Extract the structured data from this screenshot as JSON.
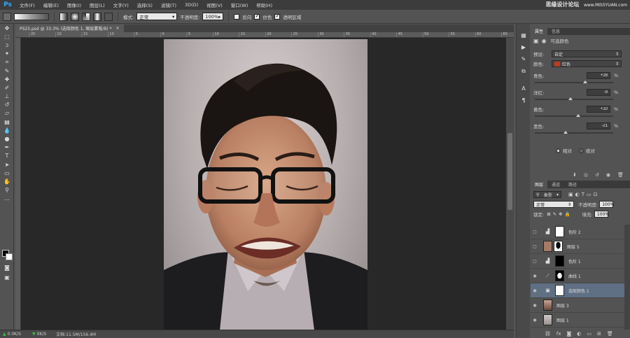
{
  "app": {
    "logo": "Ps"
  },
  "menu": [
    "文件(F)",
    "编辑(E)",
    "图像(I)",
    "图层(L)",
    "文字(Y)",
    "选择(S)",
    "滤镜(T)",
    "3D(D)",
    "视图(V)",
    "窗口(W)",
    "帮助(H)"
  ],
  "watermark": {
    "brand": "思缘设计论坛",
    "url": "www.MISSYUAN.com"
  },
  "options": {
    "mode_label": "模式:",
    "mode_value": "正常",
    "opacity_label": "不透明度:",
    "opacity_value": "100%",
    "reverse_label": "反向",
    "dither_label": "仿色",
    "transparency_label": "透明区域"
  },
  "document": {
    "tab_title": "PS25.psd @ 33.3% (选取颜色 1, 图层蒙版/8) *",
    "close": "×"
  },
  "ruler_ticks": [
    "25",
    "20",
    "15",
    "10",
    "5",
    "0",
    "5",
    "10",
    "15",
    "20",
    "25",
    "30",
    "35",
    "40",
    "45",
    "50",
    "55",
    "60",
    "65"
  ],
  "status": {
    "net_up": "0.0K/S",
    "net_down": "0K/S",
    "doc_info": "文档:11.5M/156.4M"
  },
  "properties": {
    "tabs": [
      "属性",
      "信息"
    ],
    "title": "可选颜色",
    "preset_label": "预设:",
    "preset_value": "自定",
    "colors_label": "颜色:",
    "colors_value": "红色",
    "colors_swatch": "#c0391e",
    "sliders": [
      {
        "label": "青色:",
        "value": "+28",
        "unit": "%",
        "position": 0.64
      },
      {
        "label": "洋红:",
        "value": "-9",
        "unit": "%",
        "position": 0.455
      },
      {
        "label": "黄色:",
        "value": "+10",
        "unit": "%",
        "position": 0.55
      },
      {
        "label": "黑色:",
        "value": "-21",
        "unit": "%",
        "position": 0.395
      }
    ],
    "method_relative": "相对",
    "method_absolute": "绝对"
  },
  "layers": {
    "tabs": [
      "图层",
      "通道",
      "路径"
    ],
    "filter_value": "类型",
    "blend_value": "正常",
    "opacity_label": "不透明度:",
    "opacity_value": "100%",
    "lock_label": "锁定:",
    "fill_label": "填充:",
    "fill_value": "100%",
    "items": [
      {
        "name": "色阶 2",
        "kind": "adjustment",
        "icon": "levels-icon",
        "mask": "white",
        "visible": false,
        "selected": false
      },
      {
        "name": "图层 5",
        "kind": "pixel",
        "mask": "silhouette",
        "visible": false,
        "selected": false
      },
      {
        "name": "色阶 1",
        "kind": "adjustment",
        "icon": "levels-icon",
        "mask": "black",
        "visible": false,
        "selected": false
      },
      {
        "name": "曲线 1",
        "kind": "adjustment",
        "icon": "curves-icon",
        "mask": "oval",
        "visible": true,
        "selected": false
      },
      {
        "name": "选取颜色 1",
        "kind": "adjustment",
        "icon": "selective-color-icon",
        "mask": "white",
        "visible": true,
        "selected": true
      },
      {
        "name": "图层 3",
        "kind": "pixel",
        "mask": "none",
        "visible": true,
        "selected": false
      },
      {
        "name": "图层 1",
        "kind": "pixel",
        "mask": "none",
        "visible": true,
        "selected": false
      }
    ],
    "footer_icons": [
      "link-icon",
      "fx-icon",
      "mask-icon",
      "adjustment-icon",
      "group-icon",
      "new-layer-icon",
      "trash-icon"
    ]
  },
  "colors": {
    "selected_layer": "#5f6f84",
    "ps_blue": "#31a8ff"
  }
}
